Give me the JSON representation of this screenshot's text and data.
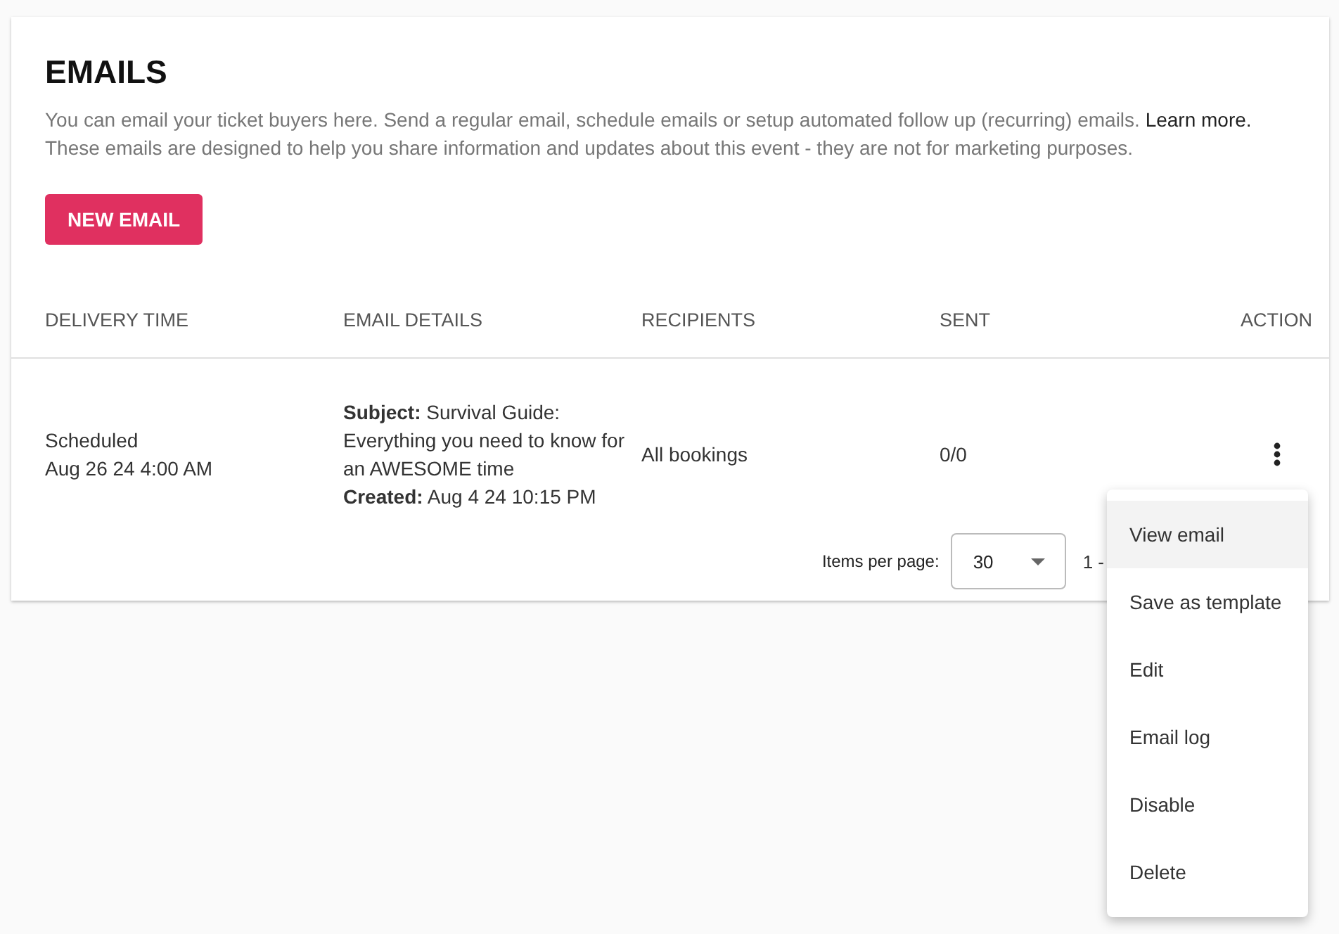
{
  "title": "EMAILS",
  "description": {
    "text": "You can email your ticket buyers here. Send a regular email, schedule emails or setup automated follow up (recurring) emails.",
    "link": "Learn more."
  },
  "note": "These emails are designed to help you share information and updates about this event - they are not for marketing purposes.",
  "new_button": "NEW EMAIL",
  "table": {
    "columns": [
      "DELIVERY TIME",
      "EMAIL DETAILS",
      "RECIPIENTS",
      "SENT",
      "ACTION"
    ],
    "rows": [
      {
        "status": "Scheduled",
        "delivery": "Aug 26 24 4:00 AM",
        "subject": "**Subject:** Survival Guide: Everything you need to know for an AWESOME time",
        "created": "**Created:** Aug 4 24 10:15 PM",
        "recipients": "All bookings",
        "sent": "0/0"
      }
    ]
  },
  "pagination": {
    "label": "Items per page:",
    "per_page": "30",
    "range": "1 -"
  },
  "menu": [
    {
      "label": "View email",
      "selected": true
    },
    {
      "label": "Save as template",
      "selected": false
    },
    {
      "label": "Edit",
      "selected": false
    },
    {
      "label": "Email log",
      "selected": false
    },
    {
      "label": "Disable",
      "selected": false
    },
    {
      "label": "Delete",
      "selected": false
    }
  ]
}
